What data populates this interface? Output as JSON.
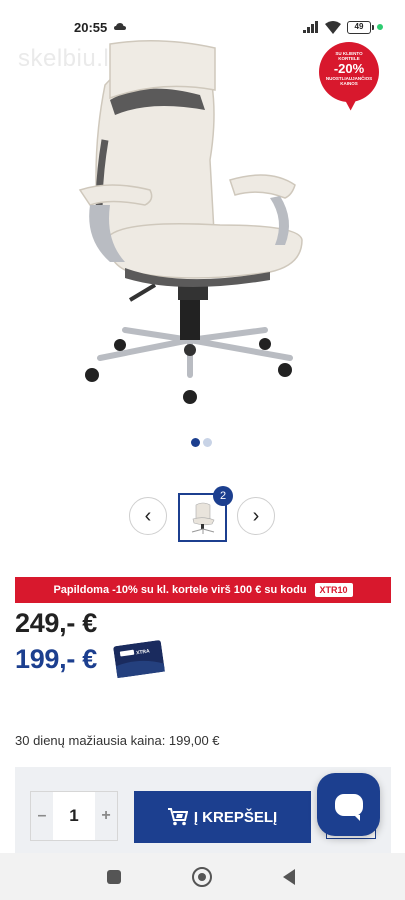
{
  "status_bar": {
    "time": "20:55",
    "battery": "49"
  },
  "product_image": {
    "watermark": "skelbiu.lt",
    "sale_badge": {
      "line1": "SU KLIENTO",
      "line2": "KORTELE",
      "discount": "-20%",
      "line3": "NUOSTLIAUJANČIOS",
      "line4": "KAINOS"
    }
  },
  "gallery": {
    "thumb_count": "2",
    "prev_icon": "‹",
    "next_icon": "›"
  },
  "promo": {
    "text": "Papildoma -10% su kl. kortele virš 100 € su kodu",
    "code": "XTR10"
  },
  "prices": {
    "old_price": "249,- €",
    "new_price": "199,- €",
    "card_label": "XTRA"
  },
  "lowest_price_text": "30 dienų mažiausia kaina: 199,00 €",
  "cart": {
    "minus": "–",
    "quantity": "1",
    "plus": "+",
    "add_label": "Į KREPŠELĮ"
  },
  "colors": {
    "brand_blue": "#1c3f8f",
    "promo_red": "#d8182d"
  }
}
